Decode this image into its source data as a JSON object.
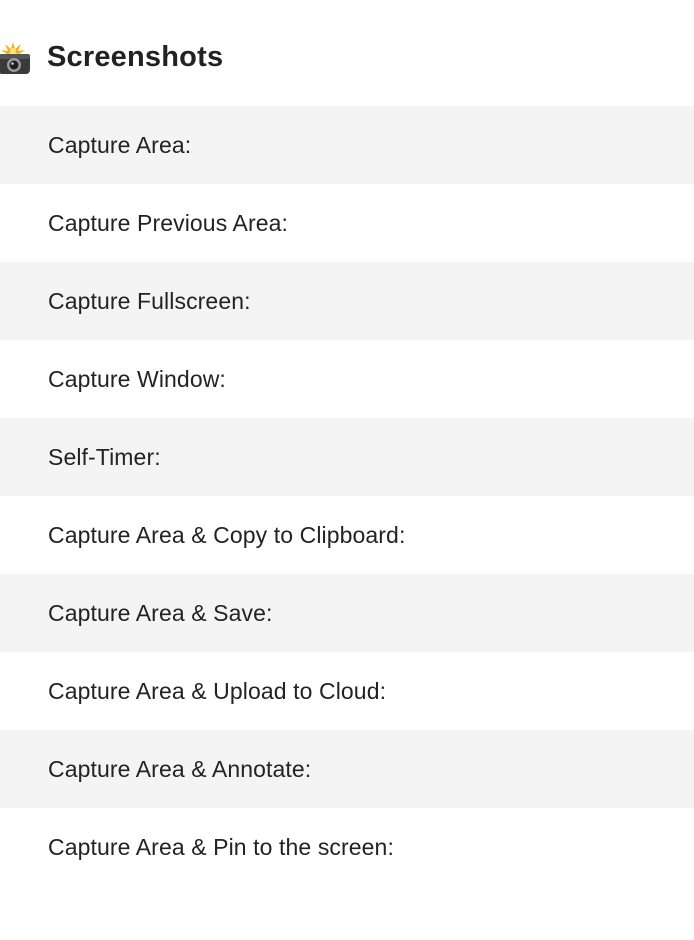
{
  "section": {
    "title": "Screenshots",
    "icon": "camera-flash-icon"
  },
  "shortcuts": [
    {
      "label": "Capture Area:"
    },
    {
      "label": "Capture Previous Area:"
    },
    {
      "label": "Capture Fullscreen:"
    },
    {
      "label": "Capture Window:"
    },
    {
      "label": "Self-Timer:"
    },
    {
      "label": "Capture Area & Copy to Clipboard:"
    },
    {
      "label": "Capture Area & Save:"
    },
    {
      "label": "Capture Area & Upload to Cloud:"
    },
    {
      "label": "Capture Area & Annotate:"
    },
    {
      "label": "Capture Area & Pin to the screen:"
    }
  ],
  "colors": {
    "row_alt": "#f4f4f4",
    "row": "#ffffff",
    "text": "#232323"
  }
}
